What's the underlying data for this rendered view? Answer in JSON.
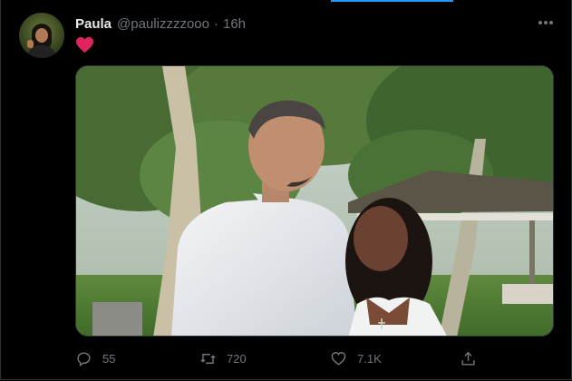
{
  "tweet": {
    "author_name": "Paula",
    "author_handle": "@paulizzzzooo",
    "separator": "·",
    "time": "16h",
    "emoji": "heart-emoji",
    "media": {
      "description": ""
    }
  },
  "actions": {
    "reply_count": "55",
    "retweet_count": "720",
    "like_count": "7.1K"
  },
  "colors": {
    "background": "#000000",
    "text": "#e7e9ea",
    "muted": "#71767b",
    "heart": "#e0245e",
    "accent": "#1d9bf0"
  },
  "icons": [
    "more-icon",
    "reply-icon",
    "retweet-icon",
    "like-icon",
    "share-icon"
  ]
}
